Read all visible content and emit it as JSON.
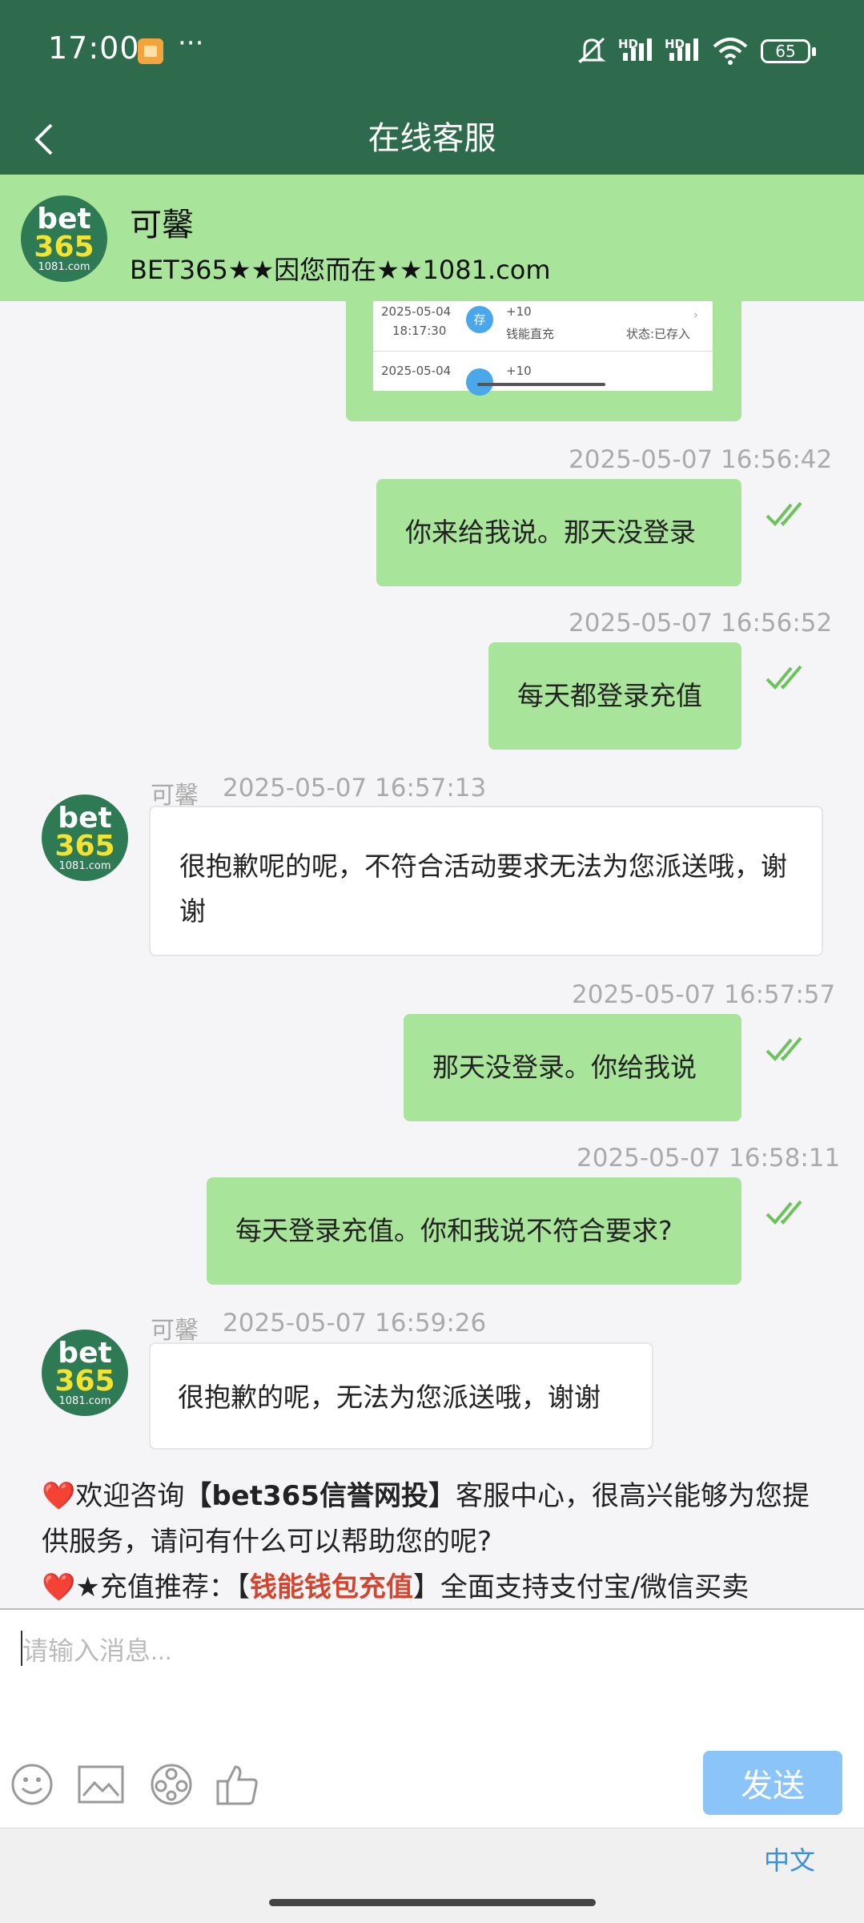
{
  "status_bar": {
    "time": "17:00",
    "more": "···",
    "battery": "65",
    "hd1": "HD",
    "hd2": "HD"
  },
  "header": {
    "title": "在线客服"
  },
  "agent": {
    "name": "可馨",
    "subtitle": "BET365★★因您而在★★1081.com",
    "avatar_line1": "bet",
    "avatar_line2": "365",
    "avatar_line3": "1081.com"
  },
  "image_msg": {
    "row1_date": "2025-05-04",
    "row1_time": "18:17:30",
    "row1_amount": "+10",
    "row1_type": "钱能直充",
    "row1_status": "状态:已存入",
    "row1_badge": "存",
    "row2_date": "2025-05-04",
    "row2_amount": "+10"
  },
  "messages": [
    {
      "timestamp": "2025-05-07 16:56:42",
      "text": "你来给我说。那天没登录"
    },
    {
      "timestamp": "2025-05-07 16:56:52",
      "text": "每天都登录充值"
    },
    {
      "sender": "可馨",
      "timestamp": "2025-05-07 16:57:13",
      "text": "很抱歉呢的呢，不符合活动要求无法为您派送哦，谢谢"
    },
    {
      "timestamp": "2025-05-07 16:57:57",
      "text": "那天没登录。你给我说"
    },
    {
      "timestamp": "2025-05-07 16:58:11",
      "text": "每天登录充值。你和我说不符合要求?"
    },
    {
      "sender": "可馨",
      "timestamp": "2025-05-07 16:59:26",
      "text": "很抱歉的呢，无法为您派送哦，谢谢"
    }
  ],
  "promo": {
    "heart": "❤️",
    "line1_a": "欢迎咨询",
    "line1_bold": "【bet365信誉网投】",
    "line1_b": "客服中心，很高兴能够为您提供服务，请问有什么可以帮助您的呢?",
    "line2_a": "★充值推荐：【",
    "line2_red": "钱能钱包充值",
    "line2_b": "】全面支持支付宝/微信买卖"
  },
  "input": {
    "placeholder": "请输入消息..."
  },
  "send_label": "发送",
  "language": "中文",
  "colors": {
    "header": "#2e6b4c",
    "bubble_out": "#a8e49a",
    "send": "#8ac4f8",
    "link": "#3a8fd8"
  }
}
